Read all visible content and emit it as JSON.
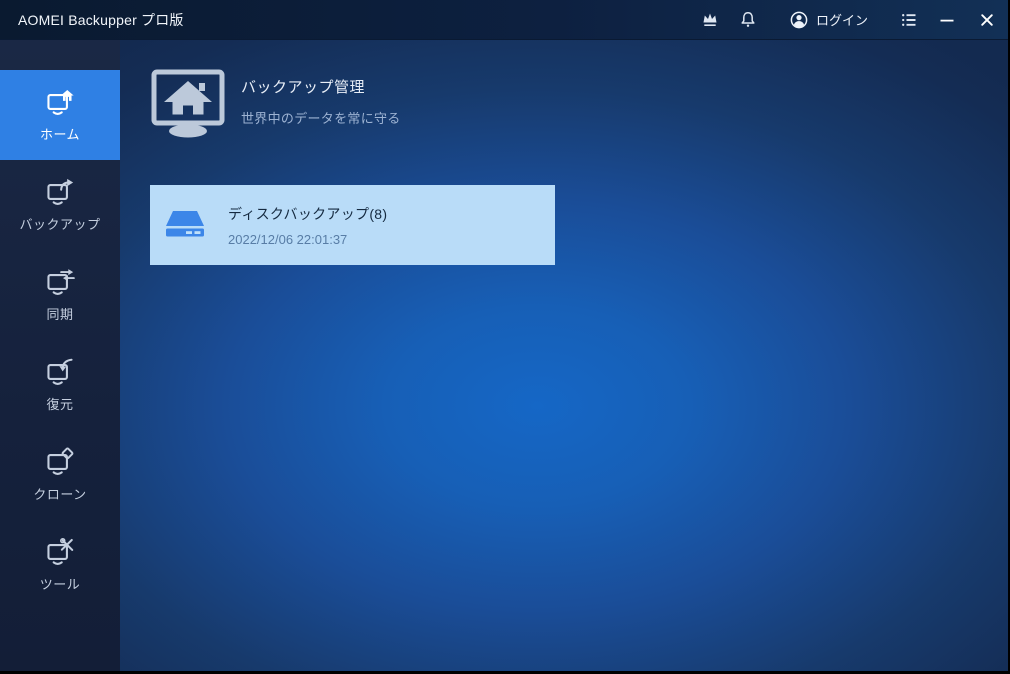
{
  "titlebar": {
    "app_title": "AOMEI Backupper プロ版",
    "login_label": "ログイン",
    "icons": [
      "crown-upgrade-icon",
      "bell-icon",
      "user-icon",
      "list-menu-icon",
      "minimize-icon",
      "close-icon"
    ]
  },
  "sidebar": {
    "items": [
      {
        "label": "ホーム",
        "icon": "monitor-home-icon",
        "active": true
      },
      {
        "label": "バックアップ",
        "icon": "monitor-backup-icon",
        "active": false
      },
      {
        "label": "同期",
        "icon": "monitor-sync-icon",
        "active": false
      },
      {
        "label": "復元",
        "icon": "monitor-restore-icon",
        "active": false
      },
      {
        "label": "クローン",
        "icon": "monitor-clone-icon",
        "active": false
      },
      {
        "label": "ツール",
        "icon": "monitor-tools-icon",
        "active": false
      }
    ]
  },
  "main": {
    "header": {
      "title": "バックアップ管理",
      "subtitle": "世界中のデータを常に守る",
      "icon": "monitor-home-large-icon"
    },
    "backups": [
      {
        "title": "ディスクバックアップ(8)",
        "timestamp": "2022/12/06 22:01:37",
        "icon": "disk-icon"
      }
    ]
  },
  "colors": {
    "accent": "#2f80e4",
    "card_bg": "#b9dcf8",
    "card_title_text": "#152a40",
    "card_time_text": "#587da6",
    "titlebar_bg": "#0d2040",
    "sidebar_bg": "#15213c"
  }
}
